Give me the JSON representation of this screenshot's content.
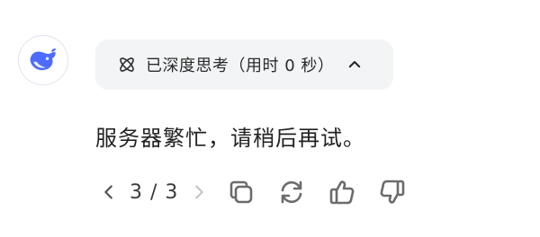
{
  "assistant": {
    "avatar_icon": "whale-logo-icon",
    "brand_color": "#4d6bfe"
  },
  "thinking": {
    "label": "已深度思考（用时 0 秒）",
    "icon": "atom-icon",
    "toggle_icon": "chevron-up-icon"
  },
  "message": {
    "text": "服务器繁忙，请稍后再试。"
  },
  "actions": {
    "pager": {
      "text": "3 / 3",
      "prev_icon": "chevron-left-icon",
      "next_icon": "chevron-right-icon"
    },
    "buttons": [
      "copy-icon",
      "regenerate-icon",
      "thumbs-up-icon",
      "thumbs-down-icon"
    ]
  },
  "colors": {
    "icon": "#6b6b6b",
    "icon_disabled": "#c6c6c6",
    "pill_bg": "#f3f4f6"
  }
}
